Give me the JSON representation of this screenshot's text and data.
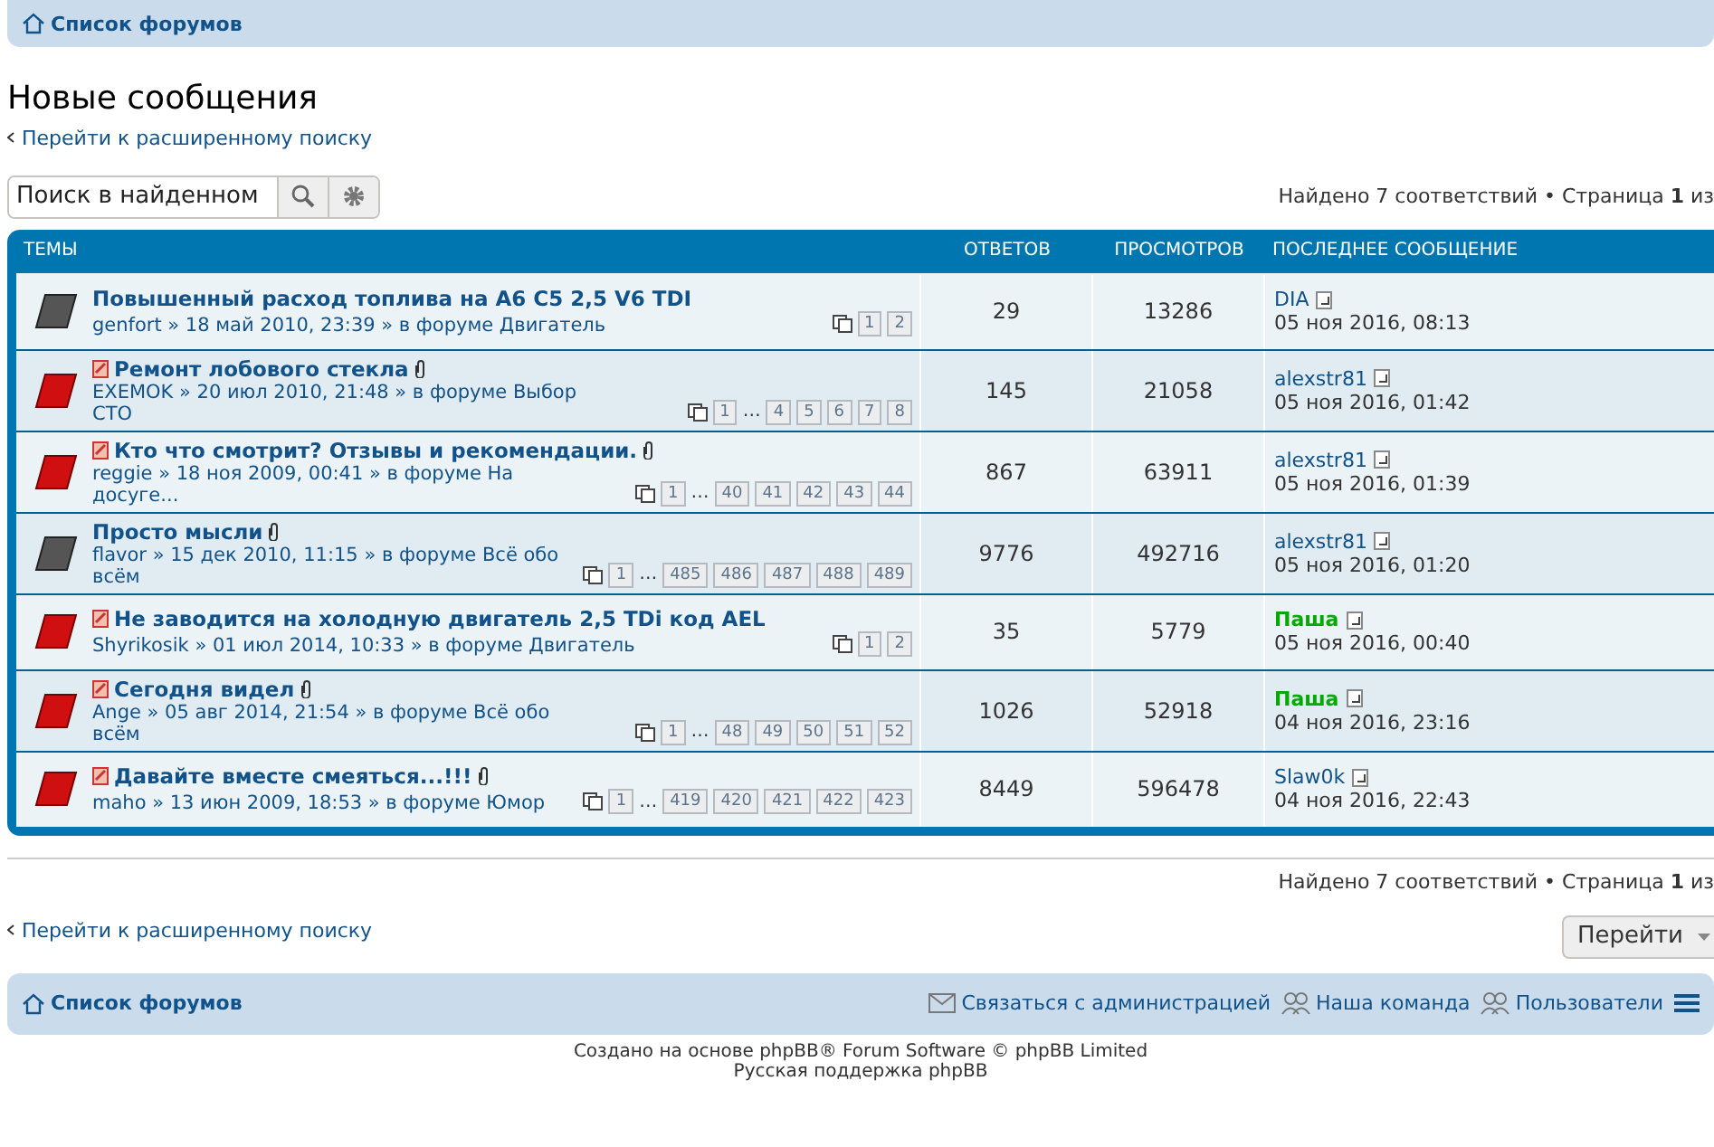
{
  "nav_top": {
    "label": "Список форумов"
  },
  "title": "Новые сообщения",
  "advanced_search_link": "Перейти к расширенному поиску",
  "search": {
    "placeholder": "Поиск в найденном"
  },
  "results_info": "Найдено 7 соответствий • Страница **1** из",
  "table": {
    "columns": [
      "ТЕМЫ",
      "ОТВЕТОВ",
      "ПРОСМОТРОВ",
      "ПОСЛЕДНЕЕ СООБЩЕНИЕ"
    ],
    "rows": [
      {
        "unread": false,
        "attachment": false,
        "title": "Повышенный расход топлива на A6 C5 2,5 V6 TDI",
        "meta": "genfort » 18 май 2010, 23:39 » в форуме Двигатель",
        "pages": [
          "1",
          "2"
        ],
        "replies": "29",
        "views": "13286",
        "last_author": "DIA",
        "color": "#105289",
        "last_time": "05 ноя 2016, 08:13"
      },
      {
        "unread": true,
        "attachment": true,
        "title": "Ремонт лобового стекла",
        "meta": "EXEMOK » 20 июл 2010, 21:48 » в форуме Выбор СТО",
        "pages": [
          "1",
          "…",
          "4",
          "5",
          "6",
          "7",
          "8"
        ],
        "replies": "145",
        "views": "21058",
        "last_author": "alexstr81",
        "color": "#105289",
        "last_time": "05 ноя 2016, 01:42"
      },
      {
        "unread": true,
        "attachment": true,
        "title": "Кто что смотрит? Отзывы и рекомендации.",
        "meta": "reggie » 18 ноя 2009, 00:41 » в форуме На досуге...",
        "pages": [
          "1",
          "…",
          "40",
          "41",
          "42",
          "43",
          "44"
        ],
        "replies": "867",
        "views": "63911",
        "last_author": "alexstr81",
        "color": "#105289",
        "last_time": "05 ноя 2016, 01:39"
      },
      {
        "unread": false,
        "attachment": true,
        "title": "Просто мысли",
        "meta": "flavor » 15 дек 2010, 11:15 » в форуме Всё обо всём",
        "pages": [
          "1",
          "…",
          "485",
          "486",
          "487",
          "488",
          "489"
        ],
        "replies": "9776",
        "views": "492716",
        "last_author": "alexstr81",
        "color": "#105289",
        "last_time": "05 ноя 2016, 01:20"
      },
      {
        "unread": true,
        "attachment": false,
        "title": "Не заводится на холодную двигатель 2,5 TDi код AEL",
        "meta": "Shyrikosik » 01 июл 2014, 10:33 » в форуме Двигатель",
        "pages": [
          "1",
          "2"
        ],
        "replies": "35",
        "views": "5779",
        "last_author": "Паша",
        "color": "#00aa00",
        "last_time": "05 ноя 2016, 00:40"
      },
      {
        "unread": true,
        "attachment": true,
        "title": "Сегодня видел",
        "meta": "Ange » 05 авг 2014, 21:54 » в форуме Всё обо всём",
        "pages": [
          "1",
          "…",
          "48",
          "49",
          "50",
          "51",
          "52"
        ],
        "replies": "1026",
        "views": "52918",
        "last_author": "Паша",
        "color": "#00aa00",
        "last_time": "04 ноя 2016, 23:16"
      },
      {
        "unread": true,
        "attachment": true,
        "title": "Давайте вместе смеяться...!!!",
        "meta": "maho » 13 июн 2009, 18:53 » в форуме Юмор",
        "pages": [
          "1",
          "…",
          "419",
          "420",
          "421",
          "422",
          "423"
        ],
        "replies": "8449",
        "views": "596478",
        "last_author": "Slaw0k",
        "color": "#105289",
        "last_time": "04 ноя 2016, 22:43"
      }
    ]
  },
  "results_info_bottom": "Найдено 7 соответствий • Страница **1** из",
  "advanced_search_link_bottom": "Перейти к расширенному поиску",
  "jump_button": "Перейти",
  "nav_bottom": {
    "home": "Список форумов",
    "links": [
      "Связаться с администрацией",
      "Наша команда",
      "Пользователи"
    ]
  },
  "footer": [
    "Создано на основе phpBB® Forum Software © phpBB Limited",
    "Русская поддержка phpBB"
  ]
}
